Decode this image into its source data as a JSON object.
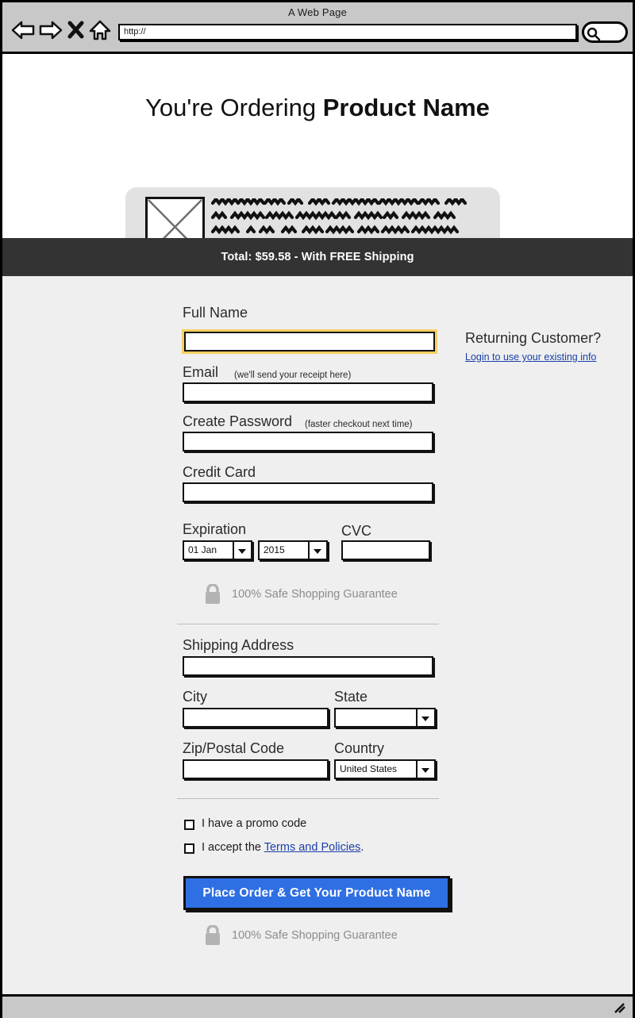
{
  "browser": {
    "title": "A Web Page",
    "url_value": "http://",
    "icons": {
      "back": "back-arrow-icon",
      "forward": "forward-arrow-icon",
      "stop": "close-x-icon",
      "home": "home-icon",
      "search": "search-icon",
      "resize": "resize-grip-icon"
    }
  },
  "hero": {
    "heading_prefix": "You're Ordering ",
    "heading_product": "Product Name",
    "image_placeholder": "image-placeholder-icon",
    "description_lines": 4
  },
  "total_bar": {
    "text": "Total: $59.58 - With FREE Shipping",
    "background": "#333333"
  },
  "returning": {
    "title": "Returning Customer?",
    "link": "Login to use your existing info"
  },
  "form": {
    "full_name": {
      "label": "Full Name",
      "value": "",
      "placeholder": "",
      "focused": true
    },
    "email": {
      "label": "Email",
      "hint": "(we'll send your receipt here)",
      "value": "",
      "placeholder": ""
    },
    "password": {
      "label": "Create Password",
      "hint": "(faster checkout next time)",
      "value": "",
      "placeholder": ""
    },
    "credit_card": {
      "label": "Credit Card",
      "value": "",
      "placeholder": ""
    },
    "expiration": {
      "label": "Expiration",
      "month_value": "01 Jan",
      "year_value": "2015"
    },
    "cvc": {
      "label": "CVC",
      "value": "",
      "placeholder": ""
    },
    "shipping_address": {
      "label": "Shipping Address",
      "value": "",
      "placeholder": ""
    },
    "city": {
      "label": "City",
      "value": "",
      "placeholder": ""
    },
    "state": {
      "label": "State",
      "value": ""
    },
    "zip": {
      "label": "Zip/Postal Code",
      "value": "",
      "placeholder": ""
    },
    "country": {
      "label": "Country",
      "value": "United States"
    }
  },
  "guarantee": {
    "text": "100% Safe Shopping Guarantee",
    "icon": "lock-icon",
    "color": "#8c8c8c"
  },
  "checkboxes": {
    "promo": {
      "label": "I have a promo code",
      "checked": false
    },
    "terms": {
      "label_before": "I accept the ",
      "link": "Terms and Policies",
      "label_after": ".",
      "checked": false
    }
  },
  "cta": {
    "label": "Place Order & Get Your Product Name",
    "color": "#2f6fe4"
  }
}
